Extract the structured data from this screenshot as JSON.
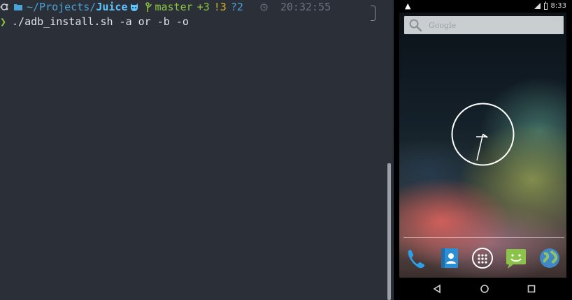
{
  "terminal": {
    "prompt": {
      "path_prefix": "~/Projects/",
      "path_dir": "Juice",
      "branch": "master",
      "git_staged": "+3",
      "git_modified": "!3",
      "git_untracked": "?2",
      "time": "20:32:55"
    },
    "command": "./adb_install.sh -a or -b -o"
  },
  "phone": {
    "status_time": "8:33",
    "search_placeholder": "Google",
    "dock_apps": [
      "phone-icon",
      "contacts-icon",
      "app-drawer-icon",
      "messaging-icon",
      "browser-icon"
    ],
    "nav_buttons": [
      "back-icon",
      "home-icon",
      "recents-icon"
    ]
  },
  "colors": {
    "terminal_bg": "#2b2f37",
    "path": "#5ec3ff",
    "branch": "#8cc63f",
    "modified": "#d7b92e"
  }
}
